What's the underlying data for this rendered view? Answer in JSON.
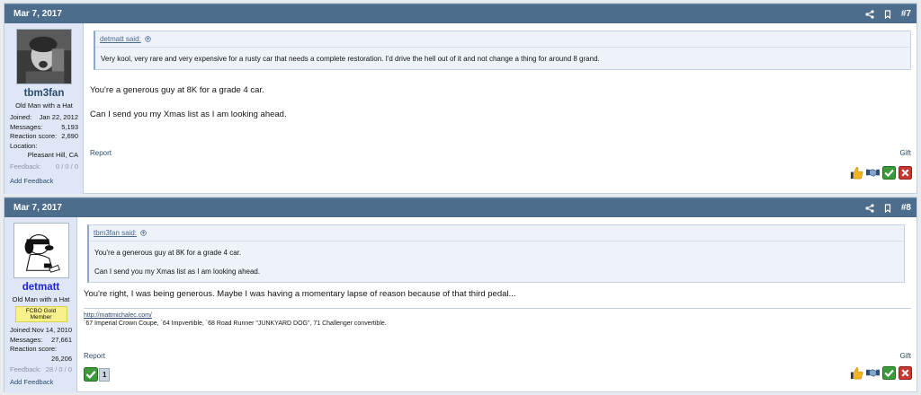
{
  "posts": [
    {
      "date": "Mar 7, 2017",
      "number": "#7",
      "user": {
        "name": "tbm3fan",
        "title": "Old Man with a Hat",
        "badge": "",
        "joined_label": "Joined:",
        "joined": "Jan 22, 2012",
        "messages_label": "Messages:",
        "messages": "5,193",
        "reaction_label": "Reaction score:",
        "reaction": "2,690",
        "location_label": "Location:",
        "location": "Pleasant Hill, CA",
        "feedback_label": "Feedback:",
        "feedback": "0 / 0 / 0",
        "add_feedback": "Add Feedback"
      },
      "quote": {
        "author": "detmatt said:",
        "lines": [
          "Very kool, very rare and very expensive for a rusty car that needs a complete restoration. I'd drive the hell out of it and not change a thing for around 8 grand."
        ]
      },
      "message": [
        "You're a generous guy at 8K for a grade 4 car.",
        "Can I send you my Xmas list as I am looking ahead."
      ],
      "report": "Report",
      "gift": "Gift"
    },
    {
      "date": "Mar 7, 2017",
      "number": "#8",
      "user": {
        "name": "detmatt",
        "title": "Old Man with a Hat",
        "badge": "FCBO Gold Member",
        "joined_label": "Joined:",
        "joined": "Nov 14, 2010",
        "messages_label": "Messages:",
        "messages": "27,661",
        "reaction_label": "Reaction score:",
        "reaction": "26,206",
        "feedback_label": "Feedback:",
        "feedback": "28 / 0 / 0",
        "add_feedback": "Add Feedback"
      },
      "quote": {
        "author": "tbm3fan said:",
        "lines": [
          "You're a generous guy at 8K for a grade 4 car.",
          "Can I send you my Xmas list as I am looking ahead."
        ]
      },
      "message": [
        "You're right, I was being generous. Maybe I was having a momentary lapse of reason because of that third pedal..."
      ],
      "signature": {
        "link": "http://mattmichalec.com/",
        "text": "`67 Imperial Crown Coupe, `64 Impvertible, `68 Road Runner \"JUNKYARD DOG\", 71 Challenger convertible."
      },
      "reaction_count": "1",
      "report": "Report",
      "gift": "Gift"
    }
  ],
  "colors": {
    "header": "#4c6d8c",
    "userpane": "#dfe7f6",
    "link": "#2b4c6e",
    "check": "#3c9a3a",
    "cross": "#c8372d"
  },
  "icons": [
    "share-icon",
    "bookmark-icon",
    "thumbs-up-icon",
    "handshake-icon",
    "check-icon",
    "cross-icon",
    "expand-quote-icon"
  ]
}
